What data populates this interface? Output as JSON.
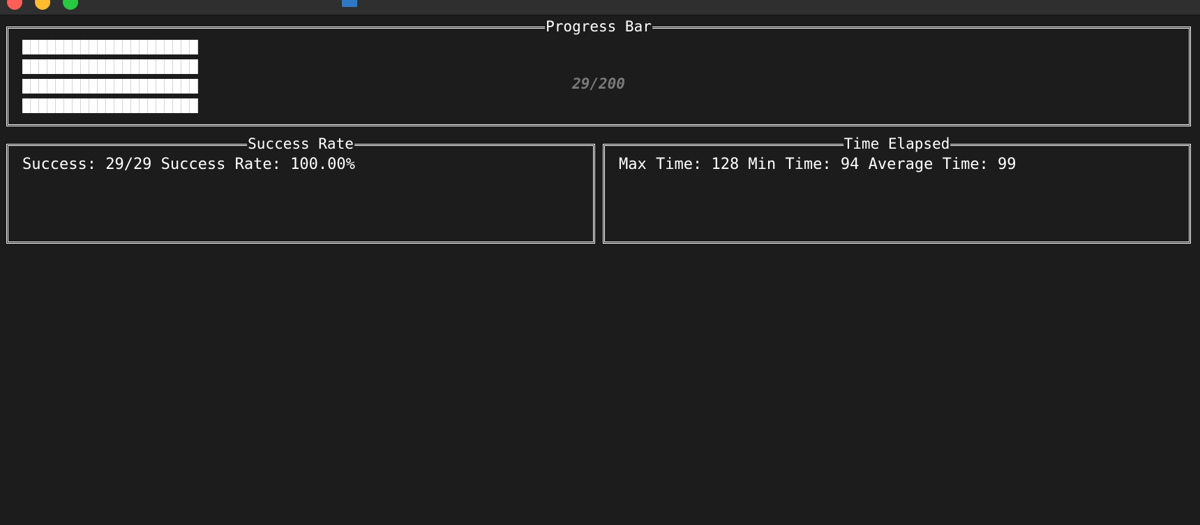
{
  "window": {
    "title": "",
    "traffic_lights": [
      "close",
      "minimize",
      "maximize"
    ]
  },
  "progress": {
    "title": "Progress Bar",
    "current": 29,
    "total": 200,
    "label": "29/200",
    "bar_rows": 4
  },
  "success": {
    "title": "Success Rate",
    "text": "Success: 29/29 Success Rate: 100.00%"
  },
  "time": {
    "title": "Time Elapsed",
    "text": "Max Time: 128 Min Time: 94 Average Time: 99"
  },
  "colors": {
    "background": "#1c1c1c",
    "border": "#ffffff",
    "progress_label": "#7a7a7a"
  }
}
